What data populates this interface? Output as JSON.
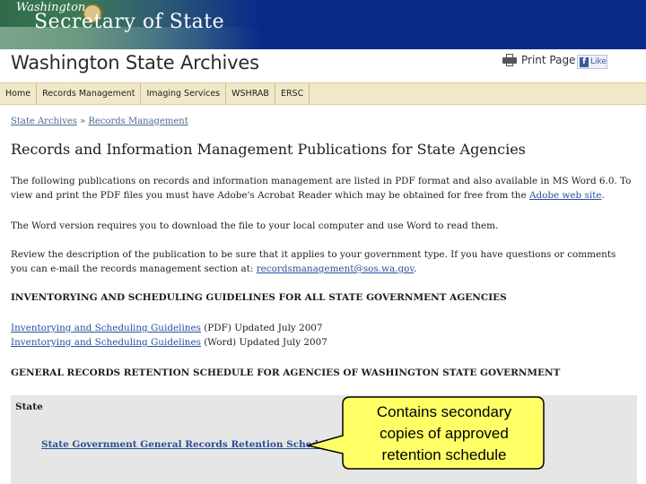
{
  "banner": {
    "small_text": "Washington",
    "big_text": "Secretary of State"
  },
  "header": {
    "site_title": "Washington State Archives",
    "print_label": "Print Page",
    "like_label": "Like"
  },
  "nav": {
    "items": [
      {
        "label": "Home"
      },
      {
        "label": "Records Management"
      },
      {
        "label": "Imaging Services"
      },
      {
        "label": "WSHRAB"
      },
      {
        "label": "ERSC"
      }
    ]
  },
  "breadcrumb": {
    "root": "State Archives",
    "separator": "»",
    "current": "Records Management"
  },
  "main": {
    "title": "Records and Information Management Publications for State Agencies",
    "para1_text": "The following publications on records and information management are listed in PDF format and also available in MS Word 6.0. To view and print the PDF files you must have Adobe's Acrobat Reader which may be obtained for free from the",
    "para1_link": "Adobe web site",
    "para1_end": ".",
    "para2_text": "The Word version requires you to download the file to your local computer and use Word to read them.",
    "para3_text": "Review the description of the publication to be sure that it applies to your government type. If you have questions or comments you can e-mail the records management section at:",
    "para3_link": "recordsmanagement@sos.wa.gov",
    "para3_end": ".",
    "section1_heading": "INVENTORYING AND SCHEDULING GUIDELINES FOR ALL STATE GOVERNMENT AGENCIES",
    "links": [
      {
        "link": "Inventorying and Scheduling Guidelines",
        "suffix": " (PDF) Updated July 2007"
      },
      {
        "link": "Inventorying and Scheduling Guidelines",
        "suffix": " (Word) Updated July 2007"
      }
    ],
    "section2_heading": "GENERAL RECORDS RETENTION SCHEDULE FOR AGENCIES OF WASHINGTON STATE GOVERNMENT",
    "state_label": "State",
    "state_link": "State Government General Records Retention Schedule"
  },
  "callout": {
    "line1": "Contains secondary",
    "line2": "copies of approved",
    "line3": "retention schedule",
    "fill_color": "#ffff66"
  },
  "colors": {
    "banner_blue": "#0a2a8a",
    "nav_bg": "#f1e8c8",
    "link": "#2a4f9e"
  }
}
